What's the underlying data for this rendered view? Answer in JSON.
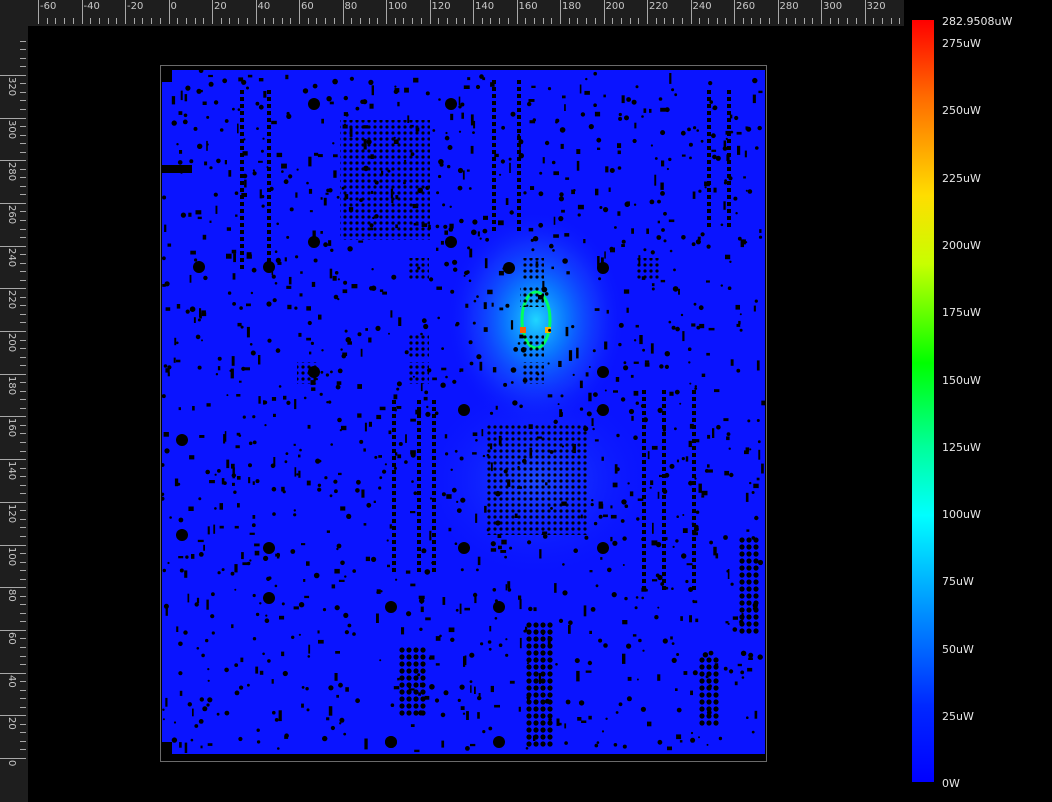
{
  "ruler_top": {
    "labels": [
      "-60",
      "-40",
      "-20",
      "0",
      "20",
      "40",
      "60",
      "80",
      "100",
      "120",
      "140",
      "160",
      "180",
      "200",
      "220",
      "240",
      "260",
      "280",
      "300",
      "320"
    ]
  },
  "ruler_left": {
    "labels": [
      "0",
      "20",
      "40",
      "60",
      "80",
      "100",
      "120",
      "140",
      "160",
      "180",
      "200",
      "220",
      "240",
      "260",
      "280",
      "300",
      "320"
    ]
  },
  "colorbar": {
    "max_label": "282.9508uW",
    "labels": [
      "275uW",
      "250uW",
      "225uW",
      "200uW",
      "175uW",
      "150uW",
      "125uW",
      "100uW",
      "75uW",
      "50uW",
      "25uW",
      "0W"
    ],
    "colors": {
      "high": "#ff0000",
      "low": "#0000ff"
    }
  },
  "heatmap": {
    "background_color": "#0a14ff",
    "hotspot_color": "#00c8ff",
    "peak_color": "#ff6400"
  }
}
